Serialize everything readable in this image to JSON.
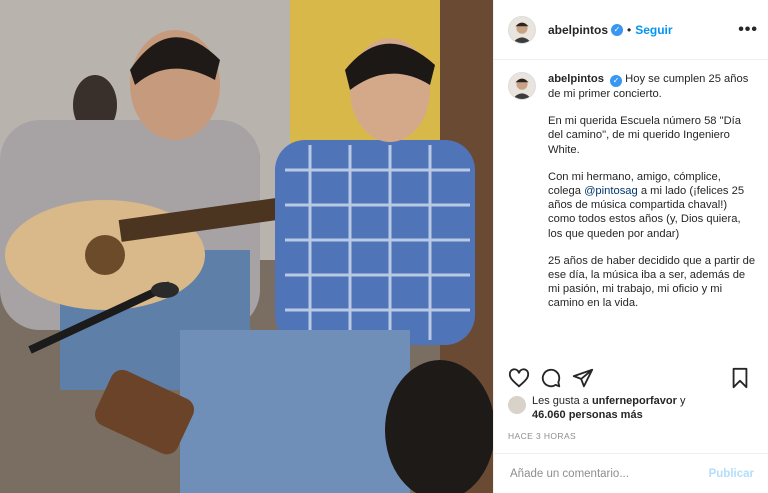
{
  "post": {
    "username": "abelpintos",
    "follow_label": "Seguir",
    "more_label": "•••",
    "verified_glyph": "✓",
    "caption": {
      "line1": "Hoy se cumplen 25 años de mi primer concierto.",
      "para2": "En mi querida Escuela número 58 \"Día del camino\", de mi querido Ingeniero White.",
      "para3_before": "Con mi hermano, amigo, cómplice, colega ",
      "para3_mention": "@pintosag",
      "para3_after": " a mi lado (¡felices 25 años de música compartida chaval!) como todos estos años (y, Dios quiera, los que queden por andar)",
      "para4": "25 años de haber decidido que a partir de ese día, la música iba a ser, además de mi pasión, mi trabajo, mi oficio y mi camino en la vida."
    },
    "likes": {
      "prefix": "Les gusta a ",
      "user": "unferneporfavor",
      "connector": " y",
      "count": "46.060 personas más"
    },
    "timestamp": "HACE 3 HORAS",
    "comment": {
      "placeholder": "Añade un comentario...",
      "publish_label": "Publicar"
    },
    "icons": [
      "heart-icon",
      "comment-icon",
      "share-icon",
      "bookmark-icon",
      "verified-icon",
      "more-icon"
    ],
    "colors": {
      "accent": "#0095f6",
      "verified": "#3897f0",
      "publish_disabled": "#b2dffc",
      "meta": "#8e8e8e"
    }
  }
}
